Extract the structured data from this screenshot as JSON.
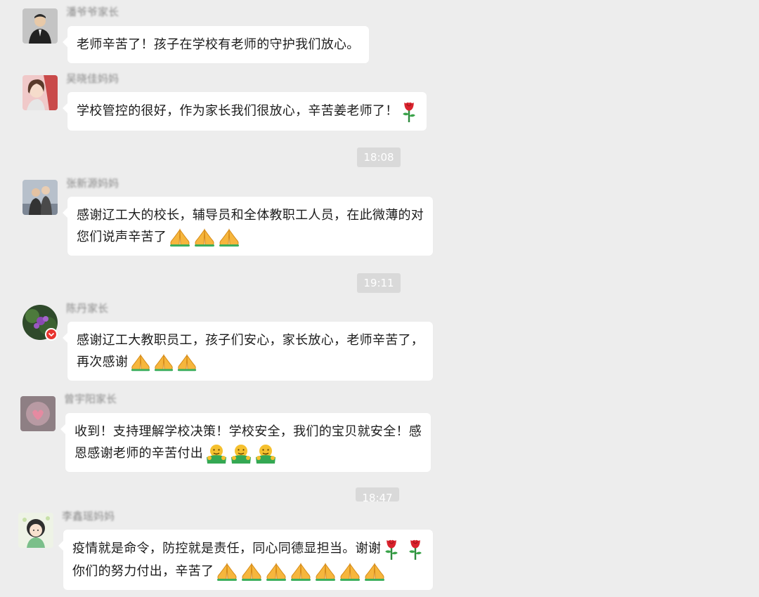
{
  "messages": [
    {
      "sender": "潘爷爷家长",
      "lines": [
        "老师辛苦了！孩子在学校有老师的守护我们放心。"
      ]
    },
    {
      "sender": "吴晓佳妈妈",
      "lines": [
        "学校管控的很好，作为家长我们很放心，辛苦姜老师了！"
      ]
    },
    {
      "sender": "张新源妈妈",
      "lines": [
        "感谢辽工大的校长，辅导员和全体教职工人员，在此微薄的对",
        "您们说声辛苦了"
      ]
    },
    {
      "sender": "陈丹家长",
      "lines": [
        "感谢辽工大教职员工，孩子们安心，家长放心，老师辛苦了，",
        "再次感谢"
      ]
    },
    {
      "sender": "曾宇阳家长",
      "lines": [
        "收到！支持理解学校决策！学校安全，我们的宝贝就安全！感",
        "恩感谢老师的辛苦付出"
      ]
    },
    {
      "sender": "李鑫瑶妈妈",
      "lines": [
        "疫情就是命令，防控就是责任，同心同德显担当。谢谢",
        "你们的努力付出，辛苦了"
      ]
    }
  ],
  "timestamps": [
    "18:08",
    "19:11",
    "18:47"
  ],
  "emojis": {
    "message_2": [
      "rose-icon"
    ],
    "message_3": [
      "pray-icon",
      "pray-icon",
      "pray-icon"
    ],
    "message_4": [
      "pray-icon",
      "pray-icon",
      "pray-icon"
    ],
    "message_5": [
      "hug-icon",
      "hug-icon",
      "hug-icon"
    ],
    "message_6_line1": [
      "rose-icon",
      "rose-icon"
    ],
    "message_6_line2": [
      "pray-icon",
      "pray-icon",
      "pray-icon",
      "pray-icon",
      "pray-icon",
      "pray-icon",
      "pray-icon"
    ]
  },
  "colors": {
    "background": "#ededed",
    "bubble": "#ffffff",
    "timestamp_bg": "#d9d9d9",
    "badge": "#e8342f"
  }
}
